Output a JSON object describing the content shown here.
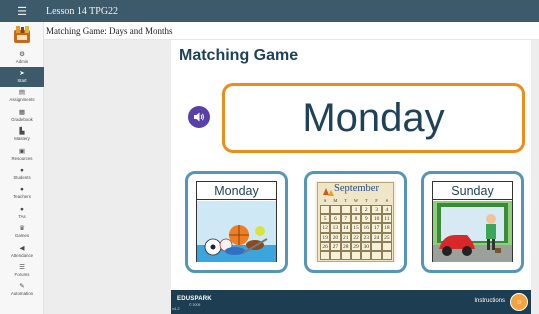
{
  "topbar": {
    "menu_icon": "hamburger-icon",
    "title": "Lesson 14 TPG22"
  },
  "subbar": {
    "title": "Matching Game: Days and Months"
  },
  "sidebar": {
    "logo_icon": "app-logo",
    "items": [
      {
        "label": "Admin",
        "icon": "gear-icon",
        "glyph": "⚙",
        "active": false
      },
      {
        "label": "Start",
        "icon": "paper-plane-icon",
        "glyph": "➤",
        "active": true
      },
      {
        "label": "Assignments",
        "icon": "assignment-icon",
        "glyph": "▤",
        "active": false
      },
      {
        "label": "Gradebook",
        "icon": "gradebook-icon",
        "glyph": "▦",
        "active": false
      },
      {
        "label": "Mastery",
        "icon": "bar-chart-icon",
        "glyph": "▙",
        "active": false
      },
      {
        "label": "Resources",
        "icon": "resources-icon",
        "glyph": "▣",
        "active": false
      },
      {
        "label": "Students",
        "icon": "student-icon",
        "glyph": "●",
        "active": false
      },
      {
        "label": "Teachers",
        "icon": "teacher-icon",
        "glyph": "●",
        "active": false
      },
      {
        "label": "TAs",
        "icon": "ta-icon",
        "glyph": "●",
        "active": false
      },
      {
        "label": "Games",
        "icon": "trophy-icon",
        "glyph": "♛",
        "active": false
      },
      {
        "label": "Attendance",
        "icon": "megaphone-icon",
        "glyph": "◀",
        "active": false
      },
      {
        "label": "Forums",
        "icon": "forum-icon",
        "glyph": "☰",
        "active": false
      },
      {
        "label": "Automation",
        "icon": "wand-icon",
        "glyph": "✎",
        "active": false
      }
    ]
  },
  "game": {
    "title": "Matching Game",
    "audio_icon": "speaker-icon",
    "prompt_word": "Monday",
    "choices": [
      {
        "label": "Monday",
        "image": "sports-balls-image"
      },
      {
        "label": "",
        "image": "september-calendar-image",
        "calendar": {
          "month": "September",
          "weekday_headers": [
            "S",
            "M",
            "T",
            "W",
            "T",
            "F",
            "S"
          ],
          "rows": [
            [
              "",
              "",
              "",
              "1",
              "2",
              "3",
              "4"
            ],
            [
              "5",
              "6",
              "7",
              "8",
              "9",
              "10",
              "11"
            ],
            [
              "12",
              "13",
              "14",
              "15",
              "16",
              "17",
              "18"
            ],
            [
              "19",
              "20",
              "21",
              "22",
              "23",
              "24",
              "25"
            ],
            [
              "26",
              "27",
              "28",
              "29",
              "30",
              "",
              ""
            ],
            [
              "",
              "",
              "",
              "",
              "",
              "",
              ""
            ]
          ]
        }
      },
      {
        "label": "Sunday",
        "image": "car-wash-image"
      }
    ]
  },
  "footer": {
    "brand": "EDUSPARK",
    "brand_sub": "© 2009",
    "version": "v4.2",
    "instructions_label": "Instructions",
    "instructions_icon": "instructions-icon"
  },
  "colors": {
    "topbar": "#3d5a6a",
    "title_text": "#1f4258",
    "word_border": "#ee8c1a",
    "choice_border": "#5596b7",
    "audio_button": "#5a3fa8",
    "footer": "#1d3d52"
  }
}
